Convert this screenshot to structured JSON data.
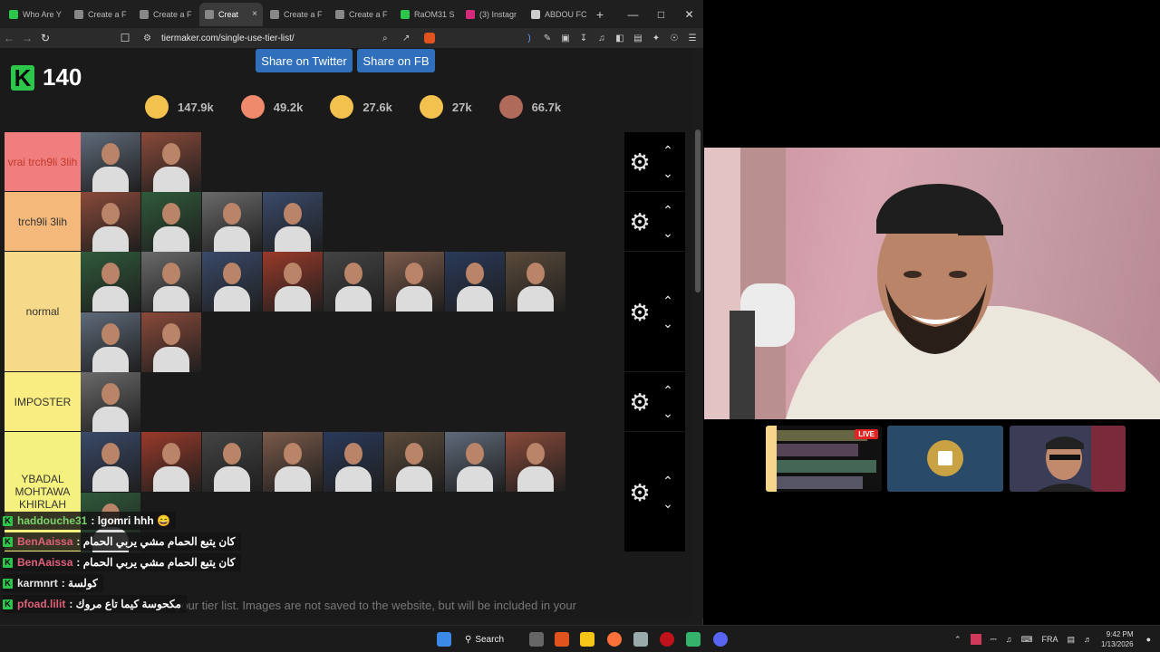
{
  "browser": {
    "tabs": [
      {
        "label": "Who Are Y",
        "color": "#2cc74a",
        "active": false
      },
      {
        "label": "Create a F",
        "color": "#888888",
        "active": false
      },
      {
        "label": "Create a F",
        "color": "#888888",
        "active": false
      },
      {
        "label": "Creat",
        "color": "#888888",
        "active": true
      },
      {
        "label": "Create a F",
        "color": "#888888",
        "active": false
      },
      {
        "label": "Create a F",
        "color": "#888888",
        "active": false
      },
      {
        "label": "RaOM31 S",
        "color": "#2cc74a",
        "active": false
      },
      {
        "label": "(3) Instagr",
        "color": "#d6297b",
        "active": false
      },
      {
        "label": "ABDOU FC",
        "color": "#cccccc",
        "active": false
      }
    ],
    "tab_close": "×",
    "new_tab": "+",
    "url": "tiermaker.com/single-use-tier-list/"
  },
  "page": {
    "share_twitter": "Share on Twitter",
    "share_fb": "Share on FB",
    "logo_letter": "K",
    "viewer_count": "140",
    "reactions": [
      {
        "icon": "grin-emoji-icon",
        "count": "147.9k"
      },
      {
        "icon": "heart-eyes-emoji-icon",
        "count": "49.2k"
      },
      {
        "icon": "laughing-emoji-icon",
        "count": "27.6k"
      },
      {
        "icon": "raised-hands-emoji-icon",
        "count": "27k"
      },
      {
        "icon": "poop-emoji-icon",
        "count": "66.7k"
      }
    ],
    "tiers": [
      {
        "label": "vrai trch9li 3lih",
        "color": "#f17e7e",
        "label_color": "#c0392b",
        "height": 66,
        "items": 2
      },
      {
        "label": "trch9li 3lih",
        "color": "#f4b87a",
        "label_color": "#333333",
        "height": 66,
        "items": 4
      },
      {
        "label": "normal",
        "color": "#f7d98a",
        "label_color": "#333333",
        "height": 133,
        "items": 10
      },
      {
        "label": "IMPOSTER",
        "color": "#f9ec80",
        "label_color": "#333333",
        "height": 66,
        "items": 1
      },
      {
        "label": "YBADAL MOHTAWA KHIRLAH",
        "color": "#f5f17e",
        "label_color": "#333333",
        "height": 133,
        "items": 9
      }
    ],
    "chat": [
      {
        "user": "haddouche31",
        "user_color": "#7bd36b",
        "message": ": lgomri hhh 😄"
      },
      {
        "user": "BenAaissa",
        "user_color": "#e0607a",
        "message": ": كان يتبع الحمام مشي يربي الحمام"
      },
      {
        "user": "BenAaissa",
        "user_color": "#e0607a",
        "message": ": كان يتبع الحمام مشي يربي الحمام"
      },
      {
        "user": "karmnrt",
        "user_color": "#e6e6e6",
        "message": ": كولسة"
      },
      {
        "user": "pfoad.lilit",
        "user_color": "#e0607a",
        "message": ": مكحوسة كيما تاع مروك"
      }
    ],
    "footnote": "in your tier list. Images are not saved to the website, but will be included in your"
  },
  "stream": {
    "live_badge": "LIVE"
  },
  "taskbar": {
    "search_label": "Search",
    "lang": "FRA",
    "time": "9:42 PM",
    "date": "1/13/2026"
  }
}
